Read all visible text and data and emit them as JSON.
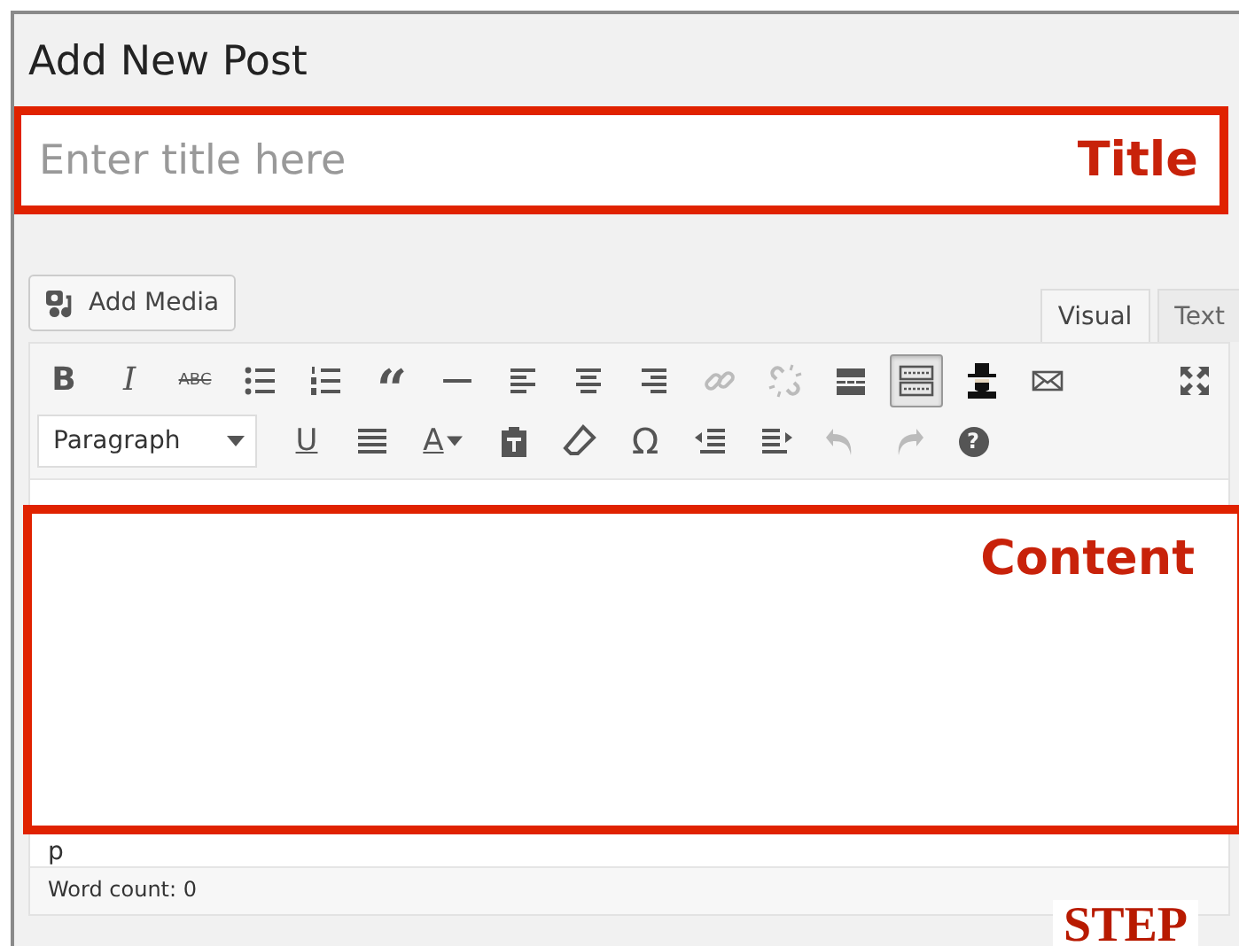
{
  "heading": "Add New Post",
  "title_field": {
    "placeholder": "Enter title here",
    "annotation": "Title"
  },
  "add_media": {
    "label": "Add Media"
  },
  "tabs": [
    {
      "label": "Visual",
      "selected": true
    },
    {
      "label": "Text",
      "selected": false
    }
  ],
  "format_dropdown": {
    "label": "Paragraph"
  },
  "toolbar": {
    "rows": [
      [
        {
          "kind": "bold",
          "label": "B",
          "disabled": false,
          "active": false
        },
        {
          "kind": "italic",
          "label": "I",
          "disabled": false,
          "active": false
        },
        {
          "kind": "strike",
          "label": "ABC",
          "disabled": false,
          "active": false
        },
        {
          "kind": "bullist",
          "disabled": false,
          "active": false
        },
        {
          "kind": "numlist",
          "disabled": false,
          "active": false
        },
        {
          "kind": "quote",
          "label": "“",
          "disabled": false,
          "active": false
        },
        {
          "kind": "hr",
          "disabled": false,
          "active": false
        },
        {
          "kind": "alignleft",
          "disabled": false,
          "active": false
        },
        {
          "kind": "aligncenter",
          "disabled": false,
          "active": false
        },
        {
          "kind": "alignright",
          "disabled": false,
          "active": false
        },
        {
          "kind": "link",
          "disabled": true,
          "active": false
        },
        {
          "kind": "unlink",
          "disabled": true,
          "active": false
        },
        {
          "kind": "more",
          "disabled": false,
          "active": false
        },
        {
          "kind": "toolbar",
          "disabled": false,
          "active": true
        },
        {
          "kind": "hatfigure",
          "disabled": false,
          "active": false
        },
        {
          "kind": "mail",
          "disabled": false,
          "active": false
        },
        {
          "kind": "fullscreen",
          "disabled": false,
          "active": false
        }
      ],
      [
        {
          "kind": "underline",
          "label": "U",
          "disabled": false,
          "active": false
        },
        {
          "kind": "justify",
          "disabled": false,
          "active": false
        },
        {
          "kind": "textcolor",
          "label": "A",
          "disabled": false,
          "active": false
        },
        {
          "kind": "paste",
          "disabled": false,
          "active": false
        },
        {
          "kind": "eraser",
          "disabled": false,
          "active": false
        },
        {
          "kind": "glyph",
          "label": "Ω",
          "disabled": false,
          "active": false
        },
        {
          "kind": "outdent",
          "disabled": false,
          "active": false
        },
        {
          "kind": "indent",
          "disabled": false,
          "active": false
        },
        {
          "kind": "undo",
          "disabled": true,
          "active": false
        },
        {
          "kind": "redo",
          "disabled": true,
          "active": false
        },
        {
          "kind": "help",
          "label": "?",
          "disabled": false,
          "active": false
        }
      ]
    ]
  },
  "content": {
    "annotation": "Content",
    "path": "p"
  },
  "word_count": "Word count: 0",
  "step_label": "STEP"
}
